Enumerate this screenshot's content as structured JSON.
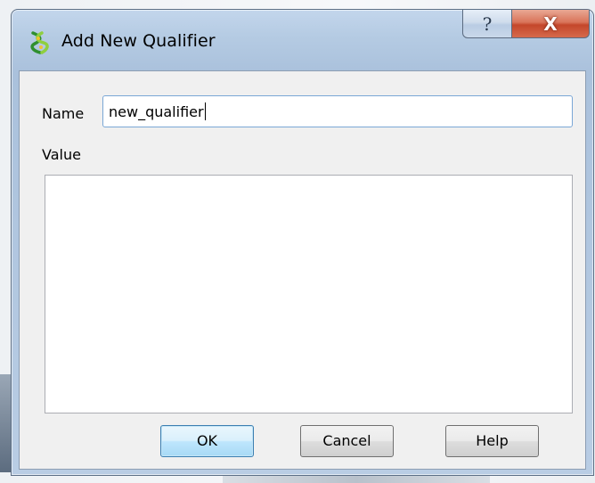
{
  "window": {
    "title": "Add New Qualifier",
    "icon": "helix-app-icon",
    "help_glyph": "?",
    "close_glyph": "X"
  },
  "form": {
    "name_label": "Name",
    "name_value": "new_qualifier",
    "value_label": "Value",
    "value_text": ""
  },
  "buttons": {
    "ok": "OK",
    "cancel": "Cancel",
    "help": "Help"
  },
  "colors": {
    "accent": "#3c7fb1",
    "close": "#c4472b",
    "input_focus": "#7aa7d6"
  }
}
